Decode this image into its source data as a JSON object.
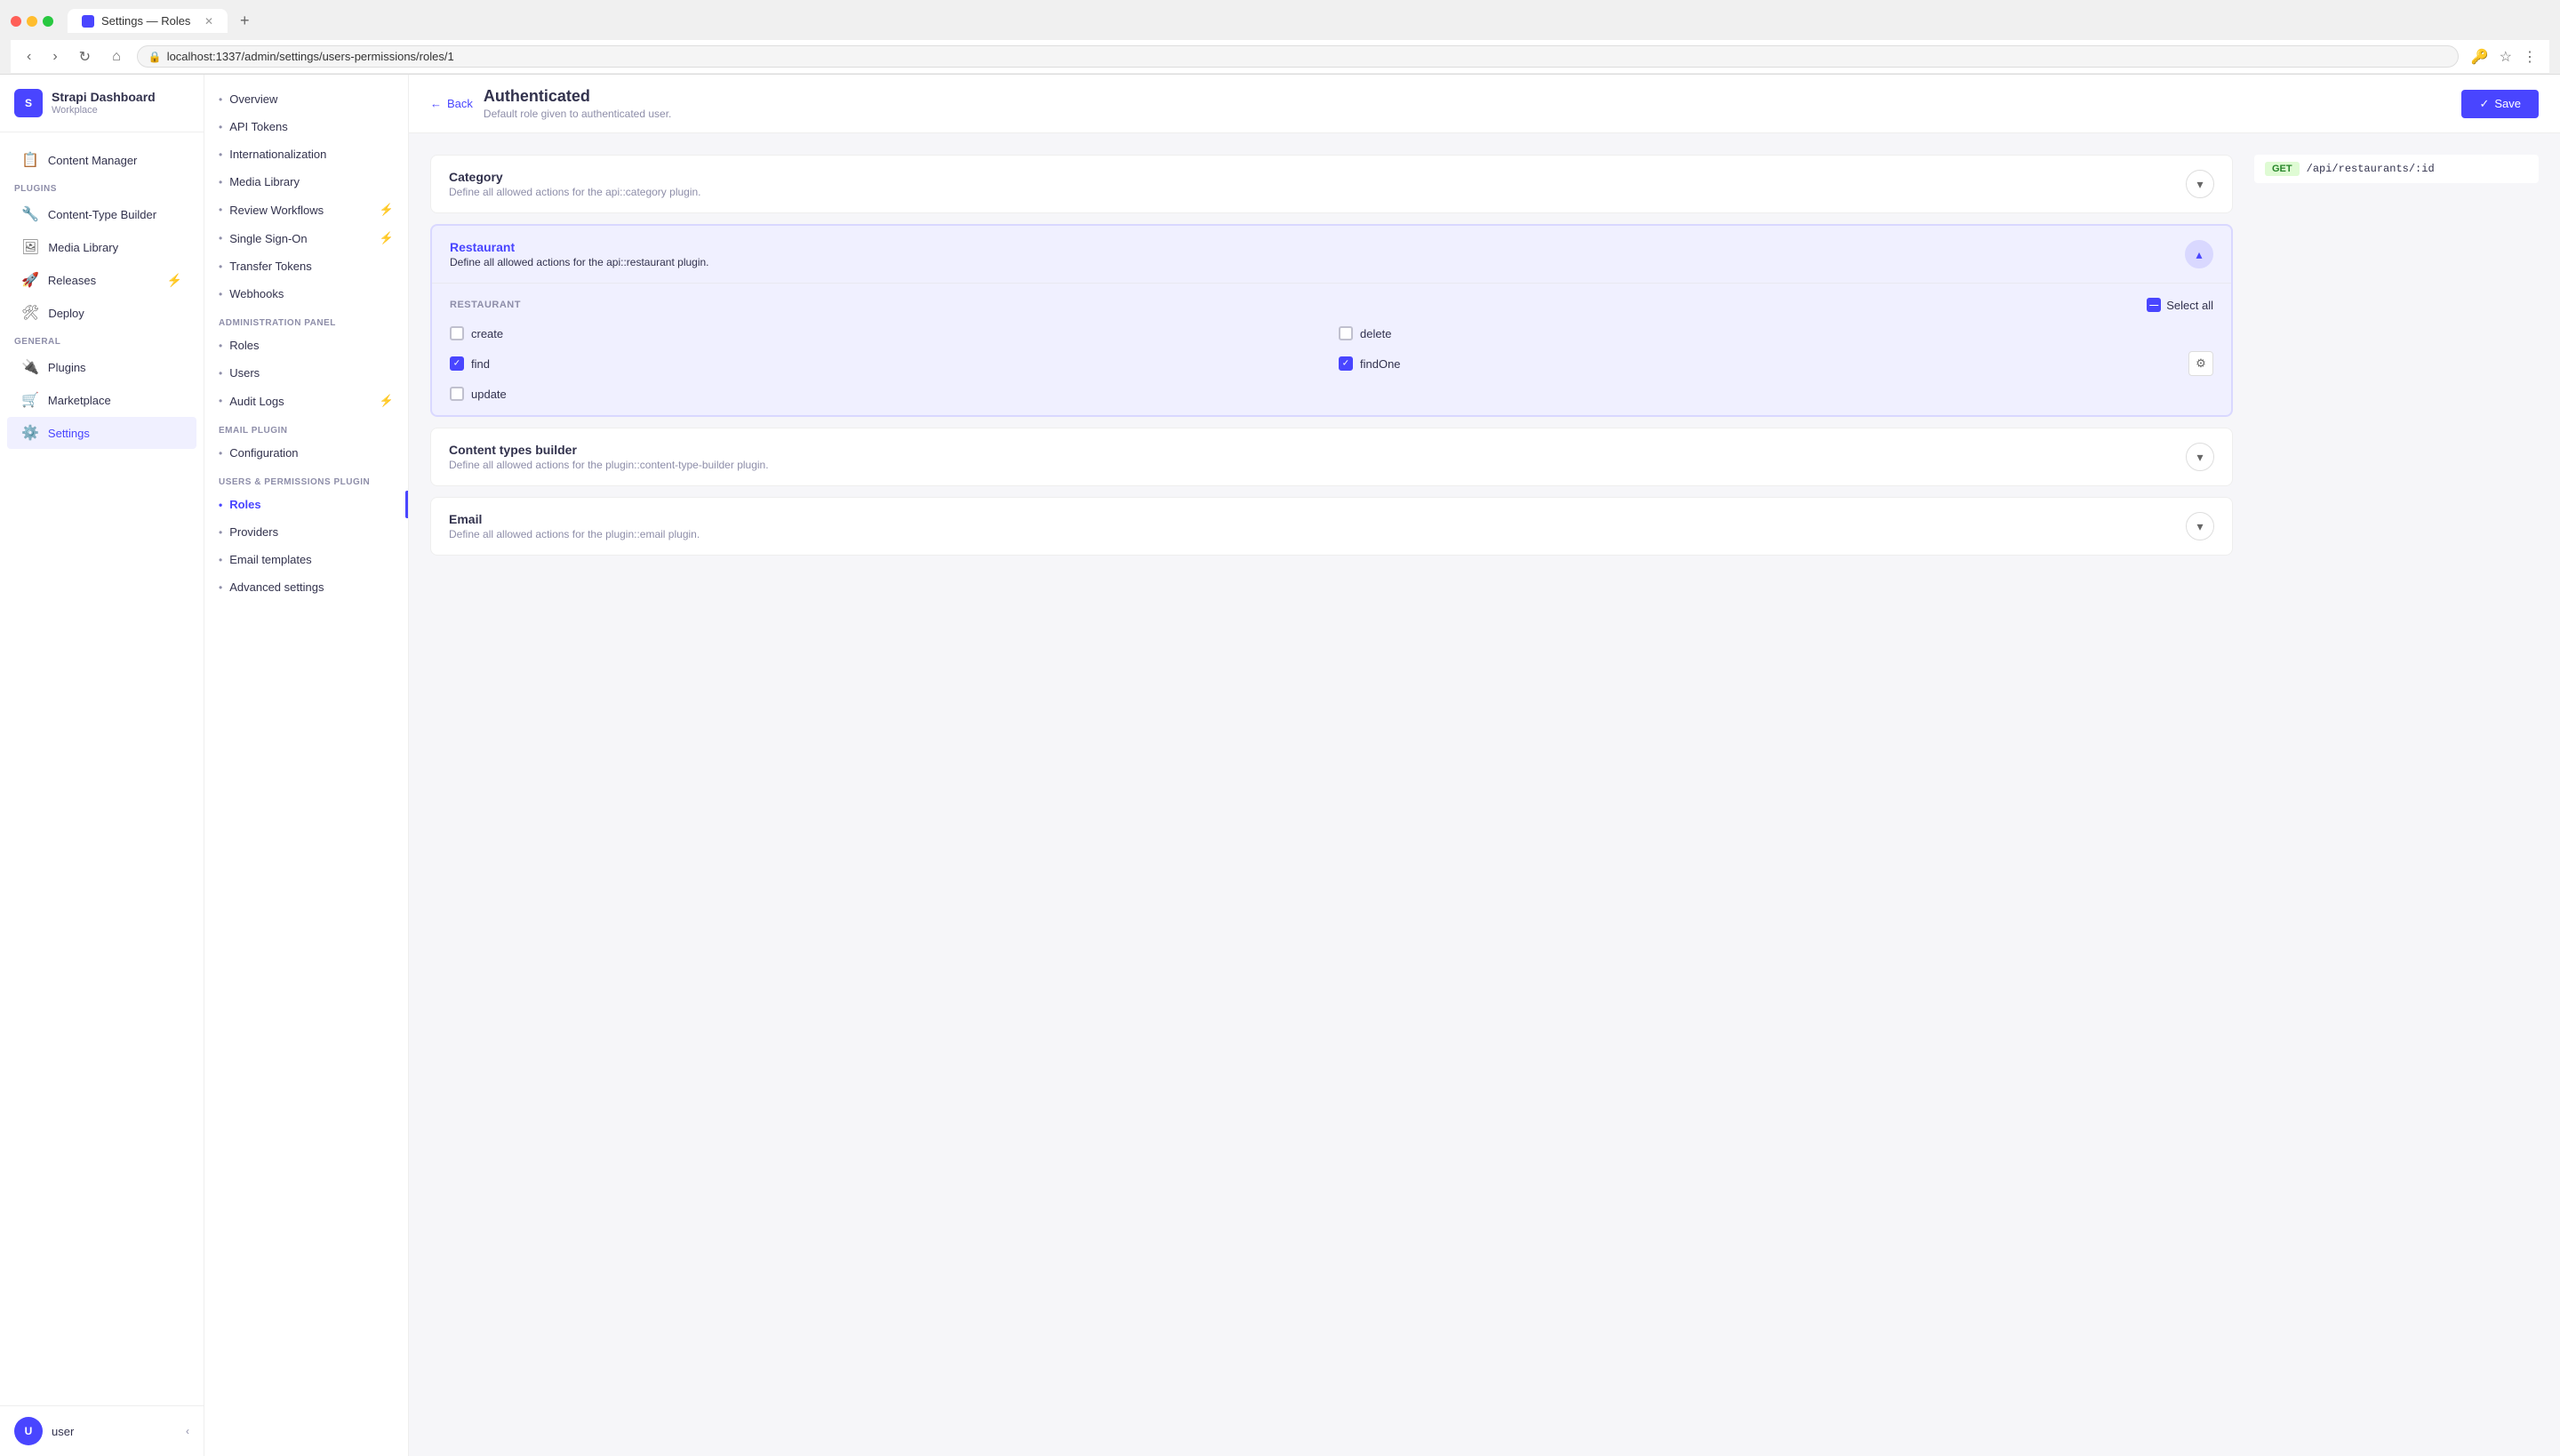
{
  "browser": {
    "tab_title": "Settings — Roles",
    "url": "localhost:1337/admin/settings/users-permissions/roles/1",
    "new_tab_label": "+"
  },
  "sidebar": {
    "brand_name": "Strapi Dashboard",
    "brand_sub": "Workplace",
    "logo_text": "S",
    "nav_items": [
      {
        "id": "content-manager",
        "label": "Content Manager",
        "icon": "📋"
      },
      {
        "id": "content-type-builder",
        "label": "Content-Type Builder",
        "icon": "🔧"
      },
      {
        "id": "media-library",
        "label": "Media Library",
        "icon": "🖼"
      },
      {
        "id": "releases",
        "label": "Releases",
        "icon": "🚀",
        "badge": "⚡"
      },
      {
        "id": "deploy",
        "label": "Deploy",
        "icon": "🛠"
      }
    ],
    "sections": {
      "plugins": "PLUGINS",
      "general": "GENERAL"
    },
    "plugins_items": [
      {
        "id": "plugins",
        "label": "Plugins",
        "icon": "🔌"
      },
      {
        "id": "marketplace",
        "label": "Marketplace",
        "icon": "🛒"
      },
      {
        "id": "settings",
        "label": "Settings",
        "icon": "⚙️",
        "active": true
      }
    ],
    "user_avatar": "U",
    "user_name": "user"
  },
  "settings_nav": {
    "items": [
      {
        "id": "overview",
        "label": "Overview"
      },
      {
        "id": "api-tokens",
        "label": "API Tokens"
      },
      {
        "id": "internationalization",
        "label": "Internationalization"
      },
      {
        "id": "media-library",
        "label": "Media Library"
      },
      {
        "id": "review-workflows",
        "label": "Review Workflows",
        "badge": "⚡"
      },
      {
        "id": "single-sign-on",
        "label": "Single Sign-On",
        "badge": "⚡"
      },
      {
        "id": "transfer-tokens",
        "label": "Transfer Tokens"
      },
      {
        "id": "webhooks",
        "label": "Webhooks"
      }
    ],
    "admin_section": "ADMINISTRATION PANEL",
    "admin_items": [
      {
        "id": "roles",
        "label": "Roles"
      },
      {
        "id": "users",
        "label": "Users"
      },
      {
        "id": "audit-logs",
        "label": "Audit Logs",
        "badge": "⚡"
      }
    ],
    "email_section": "EMAIL PLUGIN",
    "email_items": [
      {
        "id": "configuration",
        "label": "Configuration"
      }
    ],
    "users_permissions_section": "USERS & PERMISSIONS PLUGIN",
    "users_permissions_items": [
      {
        "id": "roles",
        "label": "Roles",
        "active": true
      },
      {
        "id": "providers",
        "label": "Providers"
      },
      {
        "id": "email-templates",
        "label": "Email templates"
      },
      {
        "id": "advanced-settings",
        "label": "Advanced settings"
      }
    ]
  },
  "header": {
    "back_label": "Back",
    "title": "Authenticated",
    "subtitle": "Default role given to authenticated user.",
    "save_label": "Save"
  },
  "routes_panel": {
    "route": {
      "method": "GET",
      "path": "/api/restaurants/:id"
    }
  },
  "permissions": {
    "category_card": {
      "title": "Category",
      "description": "Define all allowed actions for the api::category plugin.",
      "expanded": false
    },
    "restaurant_card": {
      "title": "Restaurant",
      "description": "Define all allowed actions for the api::restaurant plugin.",
      "expanded": true,
      "section_label": "RESTAURANT",
      "select_all_label": "Select all",
      "items": [
        {
          "id": "create",
          "label": "create",
          "checked": false
        },
        {
          "id": "delete",
          "label": "delete",
          "checked": false
        },
        {
          "id": "find",
          "label": "find",
          "checked": true
        },
        {
          "id": "findone",
          "label": "findOne",
          "checked": true,
          "has_gear": true
        },
        {
          "id": "update",
          "label": "update",
          "checked": false
        }
      ]
    },
    "content_types_builder_card": {
      "title": "Content types builder",
      "description": "Define all allowed actions for the plugin::content-type-builder plugin.",
      "expanded": false
    },
    "email_card": {
      "title": "Email",
      "description": "Define all allowed actions for the plugin::email plugin.",
      "expanded": false
    }
  }
}
